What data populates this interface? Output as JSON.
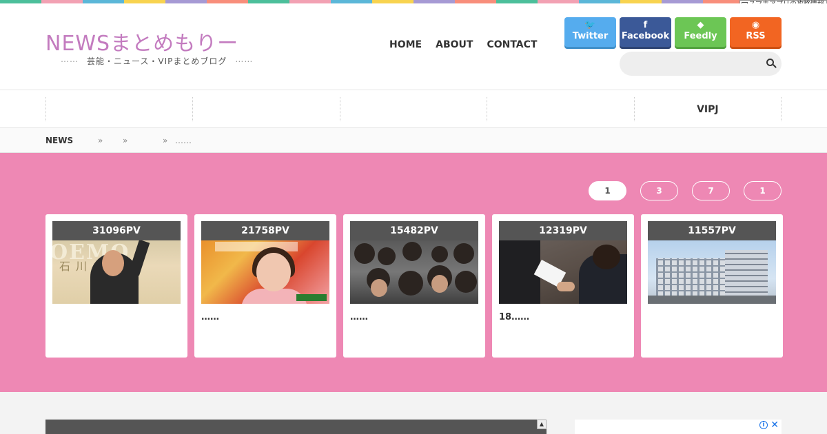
{
  "top_stripe_colors": [
    "#4cbf9b",
    "#f2a1b3",
    "#5bb7d8",
    "#f8d34f",
    "#a69ad4",
    "#f88e7b",
    "#4cbf9b",
    "#f2a1b3",
    "#5bb7d8",
    "#f8d34f",
    "#a69ad4",
    "#f88e7b",
    "#4cbf9b",
    "#f2a1b3",
    "#5bb7d8",
    "#f8d34f",
    "#a69ad4",
    "#f88e7b",
    "#4cbf9b",
    "#f2a1b3"
  ],
  "app_ad": "スマホアプリの攻略情報",
  "header": {
    "logo": "NEWSまとめもりー",
    "tagline": "芸能・ニュース・VIPまとめブログ",
    "tagline_dots_left": "⋯⋯",
    "tagline_dots_right": "⋯⋯"
  },
  "nav": [
    "HOME",
    "ABOUT",
    "CONTACT"
  ],
  "social": [
    {
      "label": "Twitter",
      "icon": "twitter-icon",
      "glyph": "🐦",
      "color": "#55acee"
    },
    {
      "label": "Facebook",
      "icon": "facebook-icon",
      "glyph": "f",
      "color": "#3b5998"
    },
    {
      "label": "Feedly",
      "icon": "feedly-icon",
      "glyph": "◆",
      "color": "#6cc655"
    },
    {
      "label": "RSS",
      "icon": "rss-icon",
      "glyph": "◉",
      "color": "#f26522"
    }
  ],
  "search": {
    "placeholder": "",
    "icon": "search-icon"
  },
  "categories": [
    "",
    "",
    "",
    "",
    "VIPJ"
  ],
  "breadcrumb": {
    "home": "NEWS",
    "sep": "»",
    "current": "……"
  },
  "pills": [
    "1",
    "3",
    "7",
    "1"
  ],
  "cards": [
    {
      "pv": "31096PV",
      "title": ""
    },
    {
      "pv": "21758PV",
      "title": "……"
    },
    {
      "pv": "15482PV",
      "title": "……"
    },
    {
      "pv": "12319PV",
      "title": "18……"
    },
    {
      "pv": "11557PV",
      "title": ""
    }
  ],
  "accent_pink": "#ee88b4",
  "logo_color": "#c37bbf"
}
